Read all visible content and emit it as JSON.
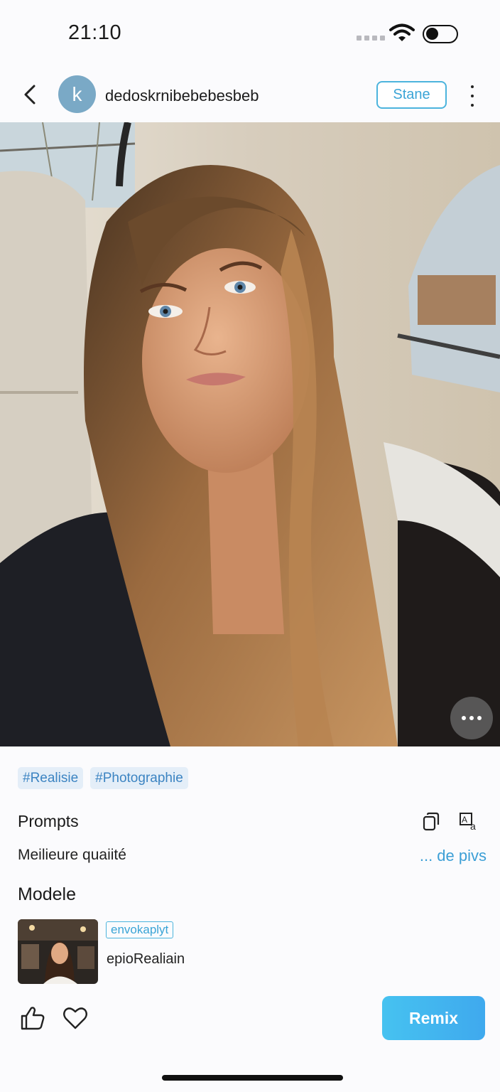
{
  "status_bar": {
    "time": "21:10"
  },
  "header": {
    "avatar_letter": "k",
    "username": "dedoskrnibebebesbeb",
    "follow_label": "Stane"
  },
  "post": {
    "image_icon": "photo-portrait",
    "tags": [
      "#Realisie",
      "#Photographie"
    ]
  },
  "prompts": {
    "title": "Prompts",
    "text": "Meilieure quaiité",
    "more_label": "... de pivs"
  },
  "model": {
    "title": "Modele",
    "badge": "envokaplyt",
    "name": "epioRealiain"
  },
  "actions": {
    "remix_label": "Remix"
  },
  "colors": {
    "accent": "#3aa4d6",
    "tag_bg": "#e4eef8",
    "remix_start": "#46c2f0",
    "remix_end": "#3fa9ee"
  }
}
